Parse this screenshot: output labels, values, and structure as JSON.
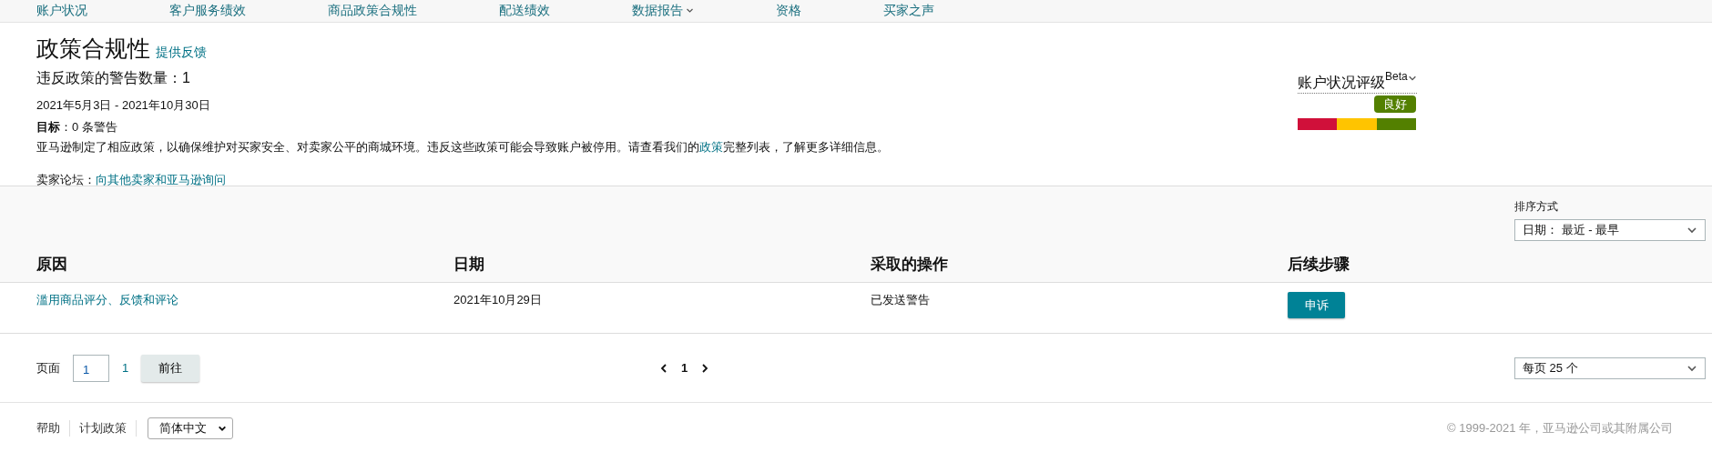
{
  "nav": {
    "items": [
      {
        "label": "账户状况",
        "dropdown": false
      },
      {
        "label": "客户服务绩效",
        "dropdown": false
      },
      {
        "label": "商品政策合规性",
        "dropdown": false
      },
      {
        "label": "配送绩效",
        "dropdown": false
      },
      {
        "label": "数据报告",
        "dropdown": true
      },
      {
        "label": "资格",
        "dropdown": false
      },
      {
        "label": "买家之声",
        "dropdown": false
      }
    ]
  },
  "header": {
    "title": "政策合规性",
    "feedback_link": "提供反馈",
    "warning_count": "违反政策的警告数量：1",
    "date_range": "2021年5月3日 - 2021年10月30日",
    "target_label": "目标",
    "target_value": "：0 条警告",
    "description": "亚马逊制定了相应政策，以确保维护对买家安全、对卖家公平的商城环境。违反这些政策可能会导致账户被停用。请查看我们的",
    "description_link": "政策",
    "description_end": "完整列表，了解更多详细信息。",
    "forum_label": "卖家论坛：",
    "forum_link": "向其他卖家和亚马逊询问"
  },
  "rating": {
    "title": "账户状况评级",
    "badge": "Beta",
    "status": "良好",
    "segments": [
      {
        "color": "#d0103a",
        "selected": false
      },
      {
        "color": "#ffc400",
        "selected": false
      },
      {
        "color": "#538000",
        "selected": true
      }
    ]
  },
  "sort": {
    "label": "排序方式",
    "value": "日期： 最近 - 最早"
  },
  "table": {
    "columns": [
      "原因",
      "日期",
      "采取的操作",
      "后续步骤"
    ],
    "rows": [
      {
        "reason": "滥用商品评分、反馈和评论",
        "date": "2021年10月29日",
        "action": "已发送警告",
        "next_step": "申诉"
      }
    ]
  },
  "pagination": {
    "page_label": "页面",
    "page_value": "1",
    "total_pages": "1",
    "go_button": "前往",
    "current": "1",
    "per_page": "每页 25 个"
  },
  "footer": {
    "links": [
      "帮助",
      "计划政策"
    ],
    "language": "简体中文",
    "copyright": "© 1999-2021 年，亚马逊公司或其附属公司"
  }
}
